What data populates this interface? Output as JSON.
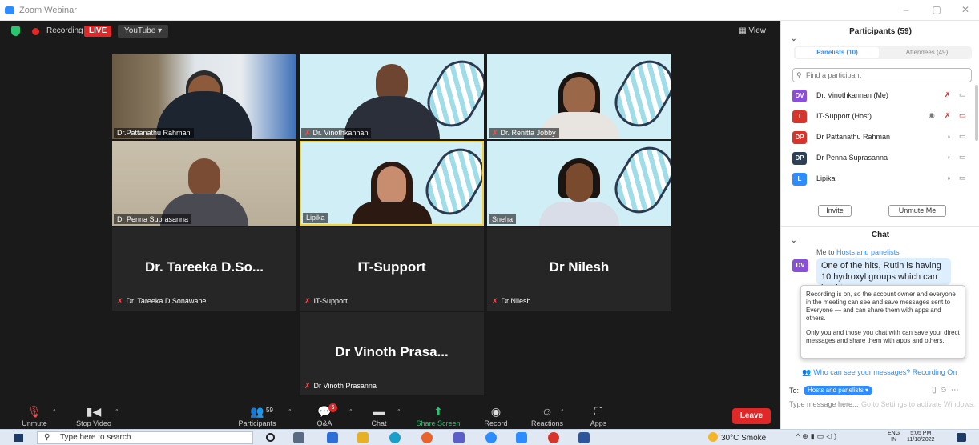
{
  "window": {
    "title": "Zoom Webinar",
    "controls": [
      "–",
      "▢",
      "✕"
    ]
  },
  "topbar": {
    "recording": "Recording",
    "live": "LIVE",
    "stream": "YouTube ▾",
    "view": "▦ View"
  },
  "tiles": [
    {
      "name": "Dr.Pattanathu Rahman",
      "muted": false
    },
    {
      "name": "Dr. Vinothkannan",
      "muted": true
    },
    {
      "name": "Dr. Renitta Jobby",
      "muted": true
    },
    {
      "name": "Dr Penna Suprasanna",
      "muted": false
    },
    {
      "name": "Lipika",
      "muted": false
    },
    {
      "name": "Sneha",
      "muted": false
    }
  ],
  "audio_only": [
    {
      "display": "Dr. Tareeka D.So...",
      "name": "Dr. Tareeka D.Sonawane"
    },
    {
      "display": "IT-Support",
      "name": "IT-Support"
    },
    {
      "display": "Dr Nilesh",
      "name": "Dr Nilesh"
    },
    {
      "display": "Dr Vinoth Prasa...",
      "name": "Dr Vinoth Prasanna"
    }
  ],
  "controls": {
    "unmute": "Unmute",
    "stop_video": "Stop Video",
    "participants": "Participants",
    "participants_count": "59",
    "qa": "Q&A",
    "qa_badge": "6",
    "chat": "Chat",
    "share": "Share Screen",
    "record": "Record",
    "reactions": "Reactions",
    "apps": "Apps",
    "leave": "Leave"
  },
  "participants_panel": {
    "title": "Participants (59)",
    "tab_panelists": "Panelists (10)",
    "tab_attendees": "Attendees (49)",
    "search_placeholder": "Find a participant",
    "rows": [
      {
        "initials": "DV",
        "name": "Dr. Vinothkannan (Me)",
        "color": "#8a4fd8"
      },
      {
        "initials": "I",
        "name": "IT-Support (Host)",
        "color": "#d9342b"
      },
      {
        "initials": "DP",
        "name": "Dr Pattanathu Rahman",
        "color": "#d9342b"
      },
      {
        "initials": "DP",
        "name": "Dr Penna Suprasanna",
        "color": "#2f4156"
      },
      {
        "initials": "L",
        "name": "Lipika",
        "color": "#2d8cff"
      }
    ],
    "invite": "Invite",
    "unmute_me": "Unmute Me"
  },
  "chat": {
    "title": "Chat",
    "me_to": "Me to",
    "recipients": "Hosts and panelists",
    "sender_initials": "DV",
    "message": "One of the hits, Rutin is having 10 hydroxyl groups which can lead to",
    "tooltip_p1": "Recording is on, so the account owner and everyone in the meeting can see and save messages sent to Everyone — and can share them with apps and others.",
    "tooltip_p2": "Only you and those you chat with can save your direct messages and share them with apps and others.",
    "who_can_see": "Who can see your messages? Recording On",
    "to_label": "To:",
    "to_value": "Hosts and panelists ▾",
    "input_placeholder": "Type message here...",
    "watermark": "Go to Settings to activate Windows."
  },
  "taskbar": {
    "search": "Type here to search",
    "weather": "30°C  Smoke",
    "lang_top": "ENG",
    "lang_bottom": "IN",
    "time": "5:05 PM",
    "date": "11/18/2022"
  },
  "colors": {
    "accent": "#2d8cff",
    "live": "#e02828",
    "share": "#28c76f"
  }
}
